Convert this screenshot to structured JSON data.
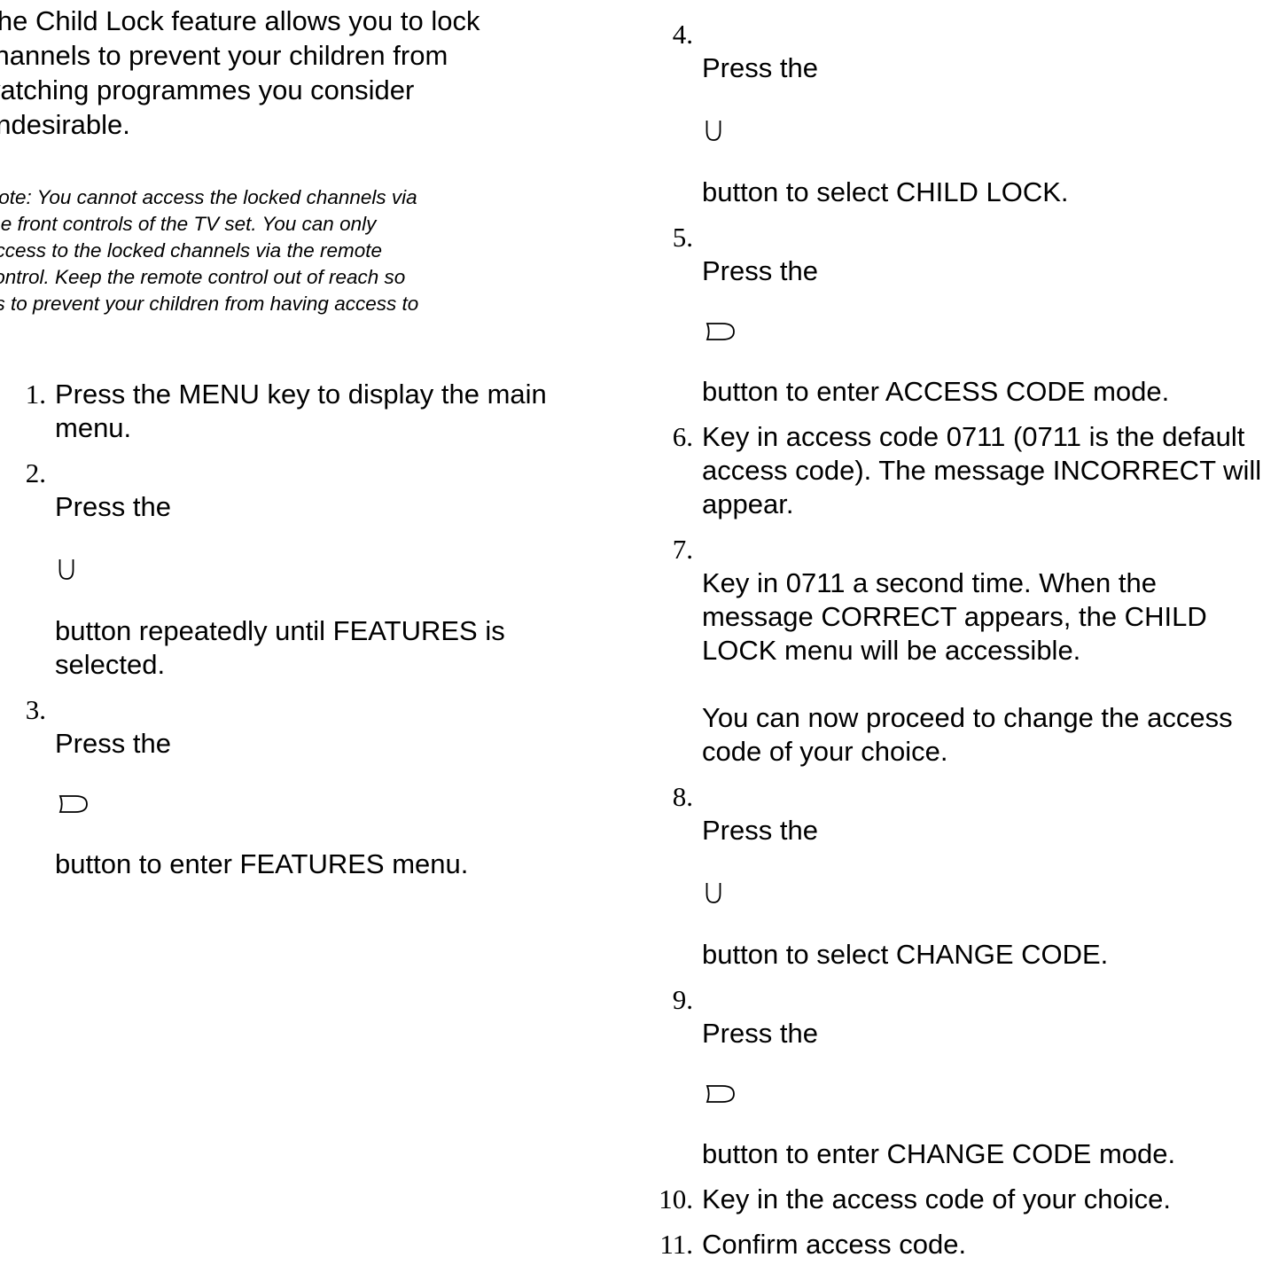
{
  "intro": "The Child Lock feature allows you to lock\nchannels to prevent your children from\nwatching programmes you consider\nundesirable.",
  "note": "Note: You cannot access the locked channels via\nthe front controls of the TV set. You can only\naccess to the locked channels via the remote\ncontrol. Keep the remote control out of reach so\nas to prevent your children from having access to",
  "icons": {
    "down": "down-cursor-icon",
    "right": "right-cursor-icon"
  },
  "steps_left": [
    {
      "num": "1.",
      "text": "Press the MENU key to display the main menu."
    },
    {
      "num": "2.",
      "pre": "Press the",
      "icon": "down-cursor-icon",
      "post": "button repeatedly until FEATURES is selected."
    },
    {
      "num": "3.",
      "pre": "Press the",
      "icon": "right-cursor-icon",
      "post": "button to enter FEATURES menu."
    }
  ],
  "steps_right": [
    {
      "num": "4.",
      "pre": "Press the",
      "icon": "down-cursor-icon",
      "post": "button to select CHILD LOCK."
    },
    {
      "num": "5.",
      "pre": "Press the",
      "icon": "right-cursor-icon",
      "post": "button to enter ACCESS CODE mode."
    },
    {
      "num": "6.",
      "text": "Key in access code 0711 (0711 is the default access code). The message INCORRECT will appear."
    },
    {
      "num": "7.",
      "text": "Key in 0711 a second time. When the message CORRECT appears, the CHILD LOCK menu will be accessible.",
      "extra": "You can now proceed to change the access code of your choice."
    },
    {
      "num": "8.",
      "pre": "Press the",
      "icon": "down-cursor-icon",
      "post": "button to select CHANGE CODE."
    },
    {
      "num": "9.",
      "pre": "Press the",
      "icon": "right-cursor-icon",
      "post": "button to enter CHANGE CODE mode."
    },
    {
      "num": "10.",
      "text": "Key in the access code of your choice."
    },
    {
      "num": "11.",
      "text": "Confirm access code."
    }
  ]
}
